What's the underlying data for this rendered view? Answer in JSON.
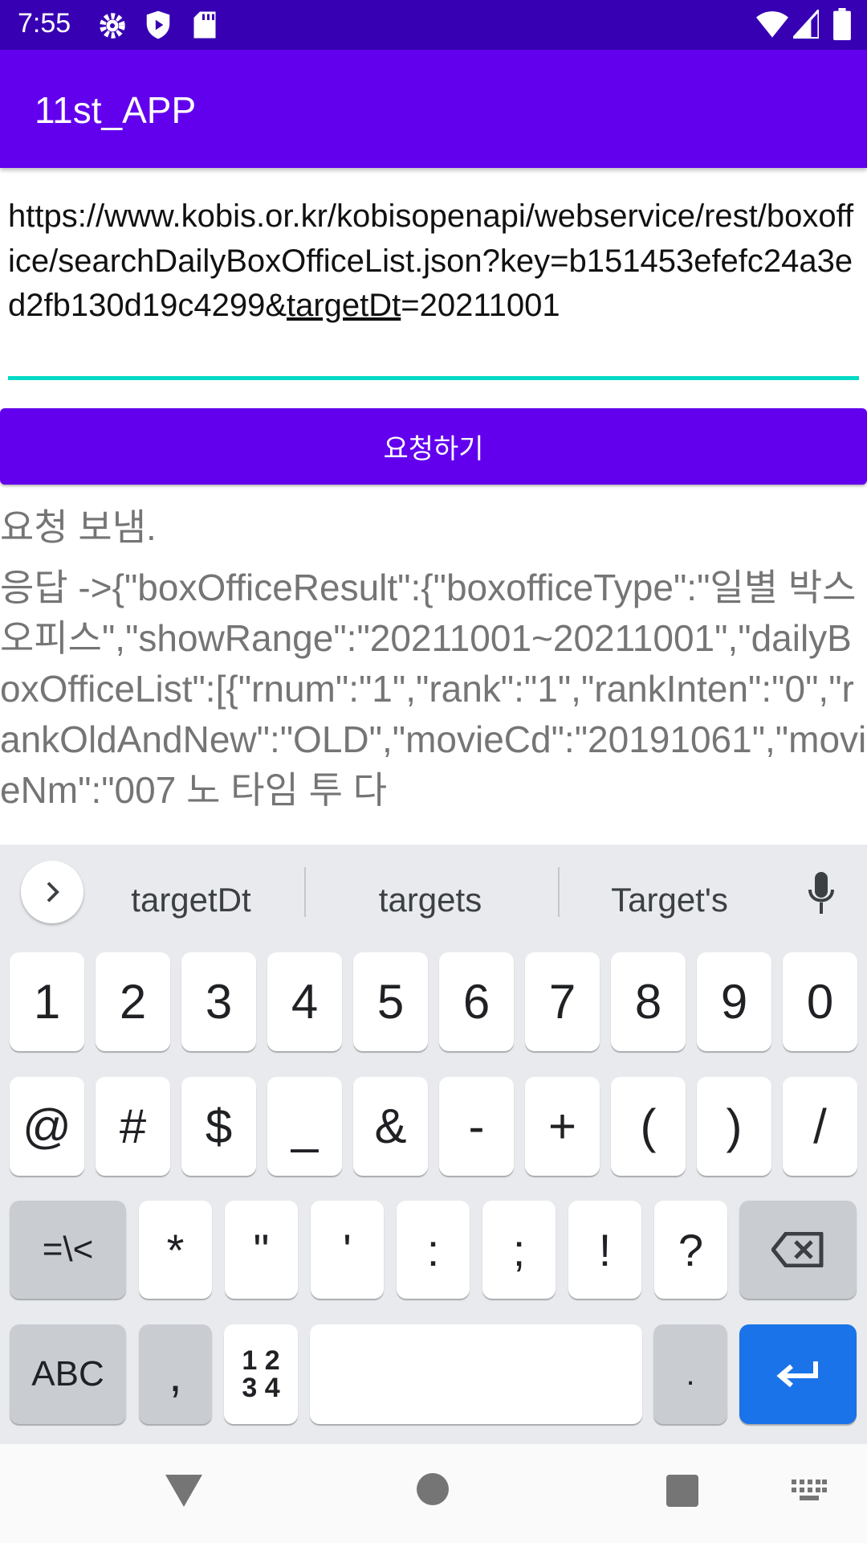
{
  "status_bar": {
    "time": "7:55",
    "icons": [
      "gear-icon",
      "shield-play-icon",
      "sd-card-icon",
      "wifi-icon",
      "signal-icon",
      "battery-icon"
    ]
  },
  "app_bar": {
    "title": "11st_APP"
  },
  "url_input": {
    "value_part1": "https://www.kobis.or.kr/kobisopenapi/webservice/rest/boxoffice/searchDailyBoxOfficeList.json?key=b151453efefc24a3ed2fb130d19c4299&",
    "value_underlined": "targetDt",
    "value_part2": "=20211001",
    "underline_color": "#03dac5"
  },
  "request_button": {
    "label": "요청하기"
  },
  "output": {
    "sent": "요청 보냄.",
    "response": "응답 ->{\"boxOfficeResult\":{\"boxofficeType\":\"일별 박스오피스\",\"showRange\":\"20211001~20211001\",\"dailyBoxOfficeList\":[{\"rnum\":\"1\",\"rank\":\"1\",\"rankInten\":\"0\",\"rankOldAndNew\":\"OLD\",\"movieCd\":\"20191061\",\"movieNm\":\"007 노 타임 투 다"
  },
  "keyboard": {
    "suggestions": [
      "targetDt",
      "targets",
      "Target's"
    ],
    "row1": [
      "1",
      "2",
      "3",
      "4",
      "5",
      "6",
      "7",
      "8",
      "9",
      "0"
    ],
    "row2": [
      "@",
      "#",
      "$",
      "_",
      "&",
      "-",
      "+",
      "(",
      ")",
      "/"
    ],
    "row3": [
      "*",
      "\"",
      "'",
      ":",
      ";",
      "!",
      "?"
    ],
    "symbols_label": "=\\<",
    "abc_label": "ABC",
    "comma": ",",
    "numpad_label": "1 2\n3 4",
    "period": ".",
    "enter_color": "#1a73e8"
  },
  "colors": {
    "primary": "#6200ee",
    "status": "#3700b3"
  }
}
